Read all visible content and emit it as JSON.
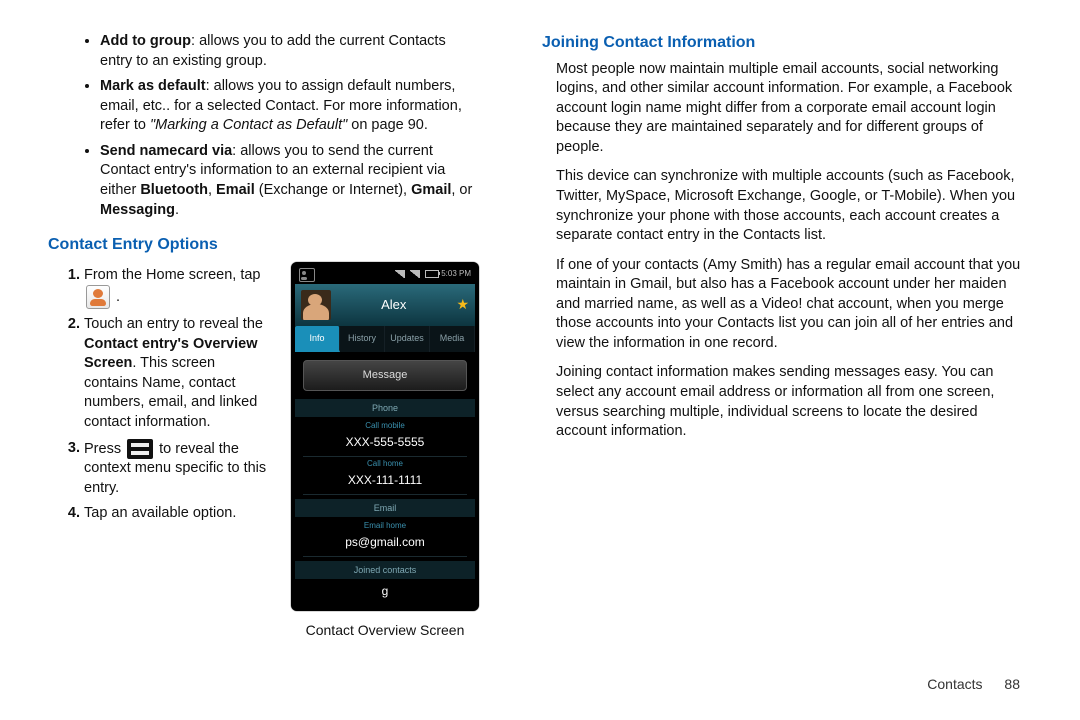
{
  "left_column": {
    "bullets": {
      "add_to_group": {
        "term": "Add to group",
        "rest": ": allows you to add the current Contacts entry to an existing group."
      },
      "mark_default": {
        "term": "Mark as default",
        "rest1": ": allows you to assign default numbers, email, etc.. for a selected Contact. For more information, refer to ",
        "ref": "\"Marking a Contact as Default\"",
        "rest2": "  on page 90."
      },
      "send_namecard": {
        "term": "Send namecard via",
        "rest1": ": allows you to send the current Contact entry's information to an external recipient via either ",
        "b1": "Bluetooth",
        "c1": ", ",
        "b2": "Email",
        "paren": " (Exchange or Internet), ",
        "b3": "Gmail",
        "c2": ", or ",
        "b4": "Messaging",
        "end": "."
      }
    },
    "entry_heading": "Contact Entry Options",
    "steps": {
      "s1a": "From the Home screen, tap ",
      "s1b": " .",
      "s2a": "Touch an entry to reveal the ",
      "s2bold": "Contact entry's Overview Screen",
      "s2b": ". This screen contains Name, contact numbers, email, and linked contact information.",
      "s3a": "Press ",
      "s3b": " to reveal the context menu specific to this entry.",
      "s4": "Tap an available option."
    },
    "figure_caption": "Contact Overview Screen"
  },
  "phone": {
    "time": "5:03 PM",
    "name": "Alex",
    "tabs": {
      "info": "Info",
      "history": "History",
      "updates": "Updates",
      "media": "Media"
    },
    "message_btn": "Message",
    "section_phone": "Phone",
    "call_mobile_label": "Call mobile",
    "call_mobile_value": "XXX-555-5555",
    "call_home_label": "Call home",
    "call_home_value": "XXX-111-1111",
    "section_email": "Email",
    "email_home_label": "Email home",
    "email_home_value": "ps@gmail.com",
    "joined_label": "Joined contacts",
    "joined_value": "g"
  },
  "right_column": {
    "heading": "Joining Contact Information",
    "p1": "Most people now maintain multiple email accounts, social networking logins, and other similar account information. For example, a Facebook account login name might differ from a corporate email account login because they are maintained separately and for different groups of people.",
    "p2": "This device can synchronize with multiple accounts (such as Facebook, Twitter, MySpace, Microsoft Exchange, Google, or T-Mobile). When you synchronize your phone with those accounts, each account creates a separate contact entry in the Contacts list.",
    "p3": "If one of your contacts (Amy Smith) has a regular email account that you maintain in Gmail, but also has a Facebook account under her maiden and married name, as well as a Video! chat account, when you merge those accounts into your Contacts list you can join all of her entries and view the information in one record.",
    "p4": "Joining contact information makes sending messages easy. You can select any account email address or information all from one screen, versus searching multiple, individual screens to locate the desired account information."
  },
  "footer": {
    "section": "Contacts",
    "page": "88"
  }
}
